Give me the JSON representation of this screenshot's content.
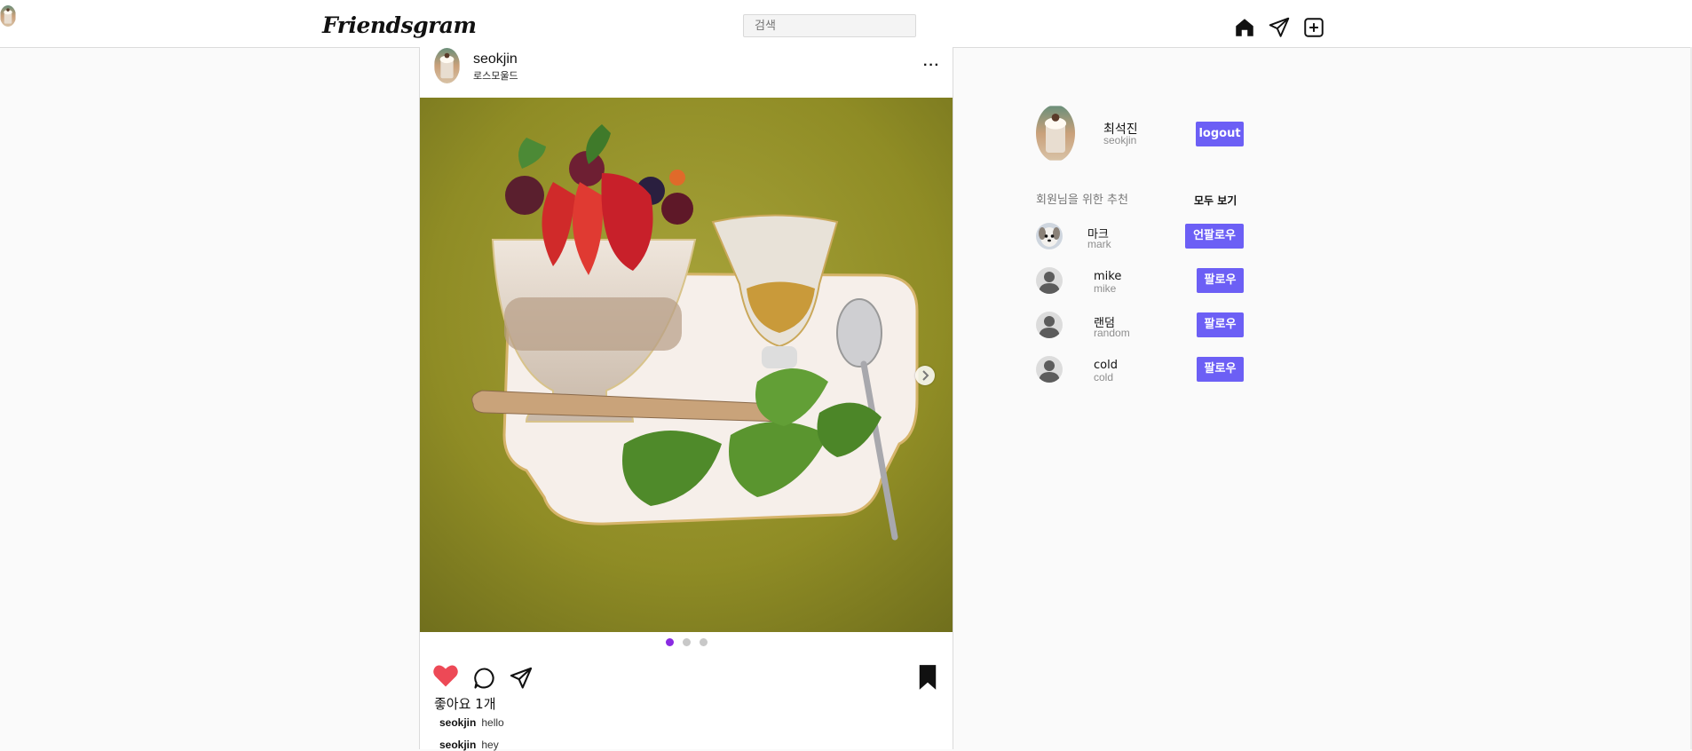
{
  "header": {
    "logo": "Friendsgram",
    "search_placeholder": "검색",
    "icons": [
      "home-icon",
      "send-icon",
      "add-post-icon",
      "profile-avatar"
    ]
  },
  "post": {
    "username": "seokjin",
    "location": "로스모울드",
    "more_label": "···",
    "carousel": {
      "total": 3,
      "active": 1
    },
    "liked": true,
    "likes_text": "좋아요 1개",
    "comments": [
      {
        "user": "seokjin",
        "text": "hello"
      },
      {
        "user": "seokjin",
        "text": "hey"
      }
    ]
  },
  "sidebar": {
    "me": {
      "name": "최석진",
      "handle": "seokjin",
      "logout_label": "logout"
    },
    "recommend_title": "회원님을 위한 추천",
    "see_all_label": "모두 보기",
    "suggestions": [
      {
        "name": "마크",
        "handle": "mark",
        "button": "언팔로우",
        "avatar": "dog-avatar"
      },
      {
        "name": "mike",
        "handle": "mike",
        "button": "팔로우",
        "avatar": "default-avatar"
      },
      {
        "name": "랜덤",
        "handle": "random",
        "button": "팔로우",
        "avatar": "default-avatar"
      },
      {
        "name": "cold",
        "handle": "cold",
        "button": "팔로우",
        "avatar": "default-avatar"
      }
    ]
  },
  "colors": {
    "accent": "#6c5ff5",
    "like_red": "#ed4956",
    "active_dot": "#8a2be2",
    "photo_background": "#9a9a2a"
  }
}
